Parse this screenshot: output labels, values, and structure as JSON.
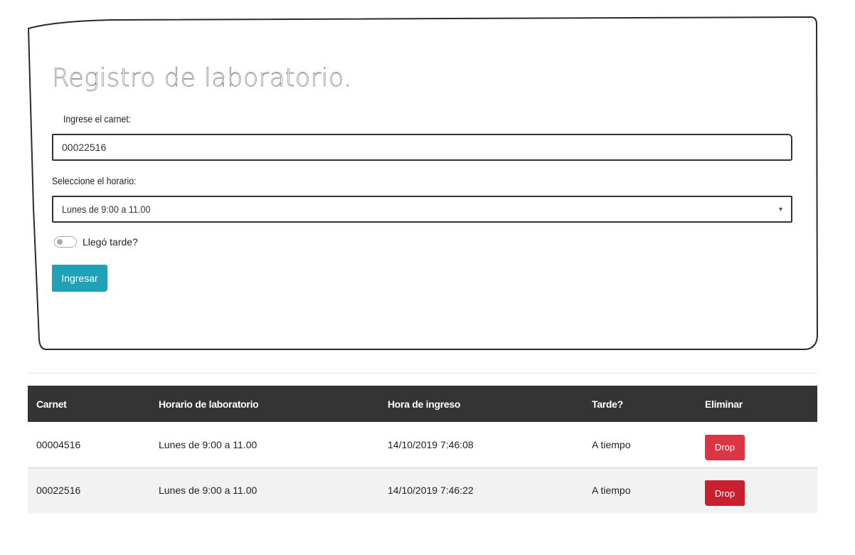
{
  "form": {
    "title": "Registro de laboratorio.",
    "carnet_label": "Ingrese el carnet:",
    "carnet_value": "00022516",
    "horario_label": "Seleccione el horario:",
    "horario_selected": "Lunes de 9:00 a 11.00",
    "late_label": "Llegó tarde?",
    "late_checked": false,
    "submit_label": "Ingresar",
    "accent_color": "#1fa2b7"
  },
  "table": {
    "headers": {
      "carnet": "Carnet",
      "horario": "Horario de laboratorio",
      "hora": "Hora de ingreso",
      "tarde": "Tarde?",
      "eliminar": "Eliminar"
    },
    "rows": [
      {
        "carnet": "00004516",
        "horario": "Lunes de 9:00 a 11.00",
        "hora": "14/10/2019 7:46:08",
        "tarde": "A tiempo",
        "action": "Drop"
      },
      {
        "carnet": "00022516",
        "horario": "Lunes de 9:00 a 11.00",
        "hora": "14/10/2019 7:46:22",
        "tarde": "A tiempo",
        "action": "Drop"
      }
    ],
    "header_color": "#343434",
    "drop_color": "#dc3545"
  }
}
